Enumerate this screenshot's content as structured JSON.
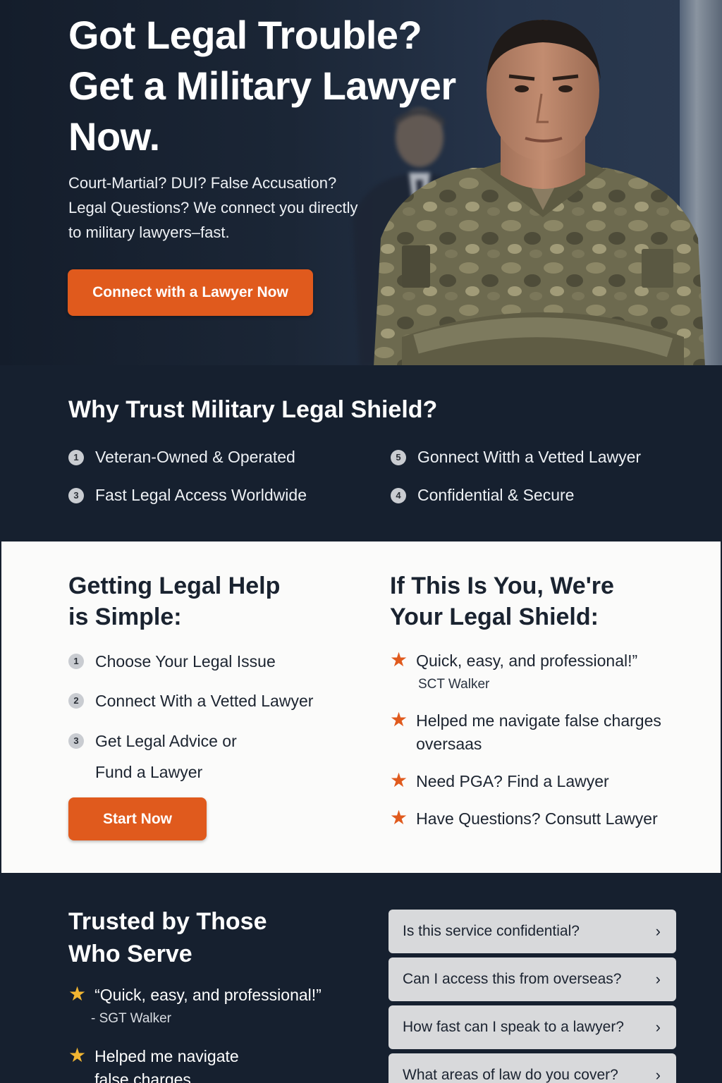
{
  "hero": {
    "title": "Got Legal Trouble? Get a Military Lawyer Now.",
    "subtitle": "Court-Martial? DUI? False Accusation? Legal Questions? We connect you directly to military lawyers–fast.",
    "cta_label": "Connect with a Lawyer Now"
  },
  "trust": {
    "title": "Why Trust Military Legal Shield?",
    "items": [
      {
        "num": "1",
        "label": "Veteran-Owned & Operated"
      },
      {
        "num": "5",
        "label": "Gonnect Witth a Vetted Lawyer"
      },
      {
        "num": "3",
        "label": "Fast Legal Access Worldwide"
      },
      {
        "num": "4",
        "label": "Confidential & Secure"
      }
    ]
  },
  "steps": {
    "title": "Getting Legal Help is Simple:",
    "items": [
      {
        "num": "1",
        "label": "Choose Your Legal Issue"
      },
      {
        "num": "2",
        "label": "Connect With a Vetted Lawyer"
      },
      {
        "num": "3",
        "label": "Get Legal Advice or"
      }
    ],
    "item3_line2": "Fund a Lawyer",
    "cta_label": "Start Now"
  },
  "shield": {
    "title": "If This Is You, We're Your Legal Shield:",
    "reviews": [
      {
        "text": "Quick, easy, and professional!”"
      },
      {
        "text": "Helped me navigate false charges oversaas"
      },
      {
        "text": "Need PGA?  Find a Lawyer"
      },
      {
        "text": "Have Questions?  Consutt Lawyer"
      }
    ],
    "review1_author": "SCT Walker"
  },
  "testimonials": {
    "title": "Trusted by Those Who Serve",
    "quotes": [
      {
        "text": "“Quick, easy, and professional!”"
      },
      {
        "text": "Helped me navigate false charges"
      }
    ],
    "quote1_author": "- SGT Walker"
  },
  "faq": {
    "items": [
      {
        "question": "Is this service confidential?"
      },
      {
        "question": "Can I access this from overseas?"
      },
      {
        "question": "How fast can I speak to a lawyer?"
      },
      {
        "question": "What areas of law do you cover?"
      }
    ]
  },
  "colors": {
    "navy": "#16202f",
    "accent_orange": "#e05a1d",
    "star_gold": "#f2b632",
    "light_section": "#fbfbfa",
    "faq_bg": "#d8d9db"
  },
  "icons": {
    "review_star": "star-icon",
    "faq_chevron": "chevron-right-icon"
  }
}
